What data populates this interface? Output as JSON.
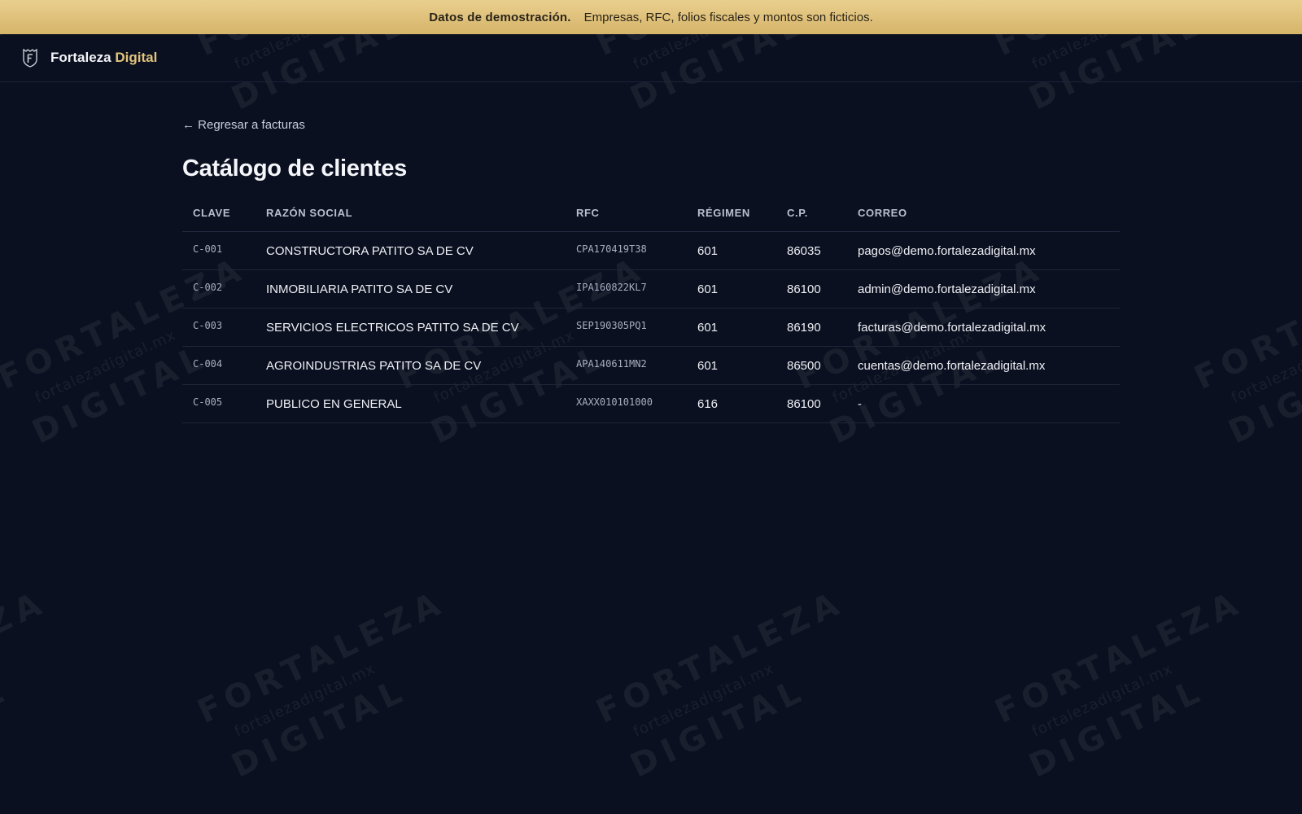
{
  "banner": {
    "title": "Datos de demostración.",
    "message": "Empresas, RFC, folios fiscales y montos son ficticios."
  },
  "brand": {
    "name": "Fortaleza",
    "accent": "Digital",
    "icon": "shield-f-icon"
  },
  "nav": {
    "back_label": "← Regresar a facturas"
  },
  "page": {
    "title": "Catálogo de clientes"
  },
  "table": {
    "headers": [
      "CLAVE",
      "RAZÓN SOCIAL",
      "RFC",
      "RÉGIMEN",
      "C.P.",
      "CORREO"
    ],
    "rows": [
      {
        "clave": "C-001",
        "razon": "CONSTRUCTORA PATITO SA DE CV",
        "rfc": "CPA170419T38",
        "regimen": "601",
        "cp": "86035",
        "correo": "pagos@demo.fortalezadigital.mx"
      },
      {
        "clave": "C-002",
        "razon": "INMOBILIARIA PATITO SA DE CV",
        "rfc": "IPA160822KL7",
        "regimen": "601",
        "cp": "86100",
        "correo": "admin@demo.fortalezadigital.mx"
      },
      {
        "clave": "C-003",
        "razon": "SERVICIOS ELECTRICOS PATITO SA DE CV",
        "rfc": "SEP190305PQ1",
        "regimen": "601",
        "cp": "86190",
        "correo": "facturas@demo.fortalezadigital.mx"
      },
      {
        "clave": "C-004",
        "razon": "AGROINDUSTRIAS PATITO SA DE CV",
        "rfc": "APA140611MN2",
        "regimen": "601",
        "cp": "86500",
        "correo": "cuentas@demo.fortalezadigital.mx"
      },
      {
        "clave": "C-005",
        "razon": "PUBLICO EN GENERAL",
        "rfc": "XAXX010101000",
        "regimen": "616",
        "cp": "86100",
        "correo": "-"
      }
    ]
  },
  "watermark": {
    "line1": "FORTALEZA",
    "line2": "fortalezadigital.mx",
    "line3": "DIGITAL"
  },
  "colors": {
    "background": "#0b1020",
    "banner": "#e0c27d",
    "accent": "#e3c47c"
  }
}
